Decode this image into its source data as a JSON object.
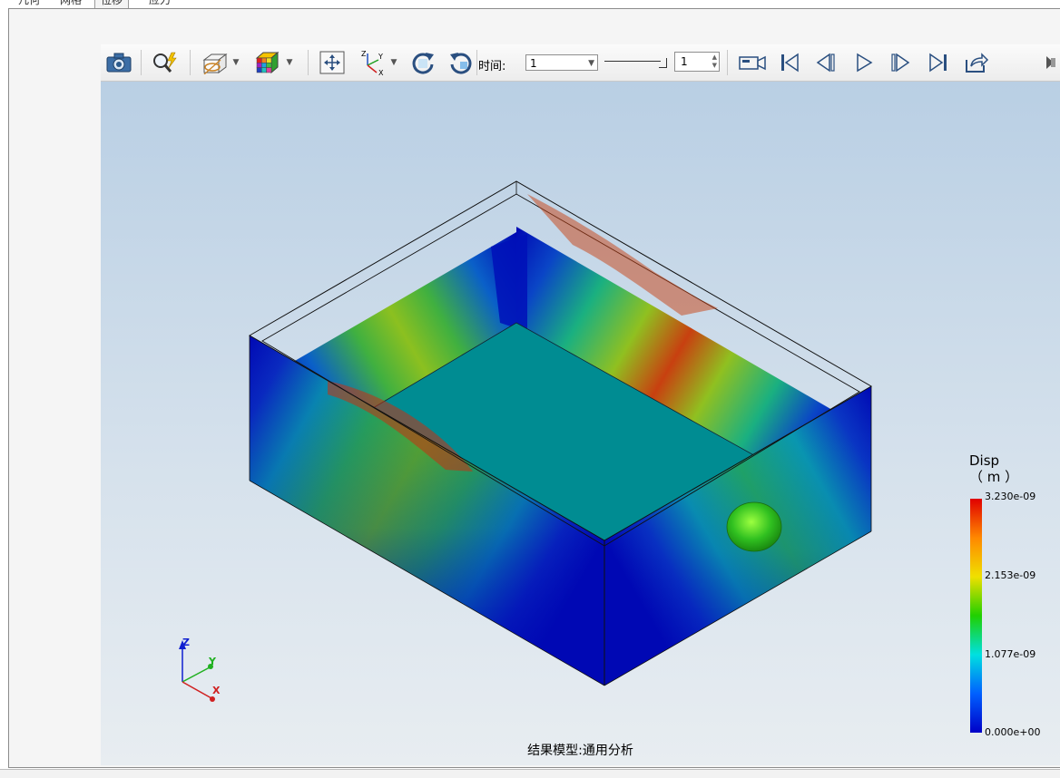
{
  "tabs": [
    {
      "label": "几何"
    },
    {
      "label": "网格"
    },
    {
      "label": "位移"
    },
    {
      "label": "应力"
    }
  ],
  "toolbar": {
    "time_label": "时间:",
    "time_value": "1",
    "frame_value": "1",
    "icons": [
      "camera-icon",
      "query-icon",
      "section-view-icon",
      "color-map-icon",
      "fit-view-icon",
      "axes-icon",
      "rotate-cw-icon",
      "rotate-ccw-icon",
      "record-icon",
      "first-frame-icon",
      "prev-frame-icon",
      "play-icon",
      "next-frame-icon",
      "last-frame-icon",
      "export-icon",
      "more-icon"
    ]
  },
  "viewport": {
    "footer": "结果模型:通用分析",
    "triad": {
      "z": "Z",
      "y": "Y",
      "x": "X"
    }
  },
  "legend": {
    "title": "Disp",
    "unit": "（ m ）",
    "max": "3.230e-09",
    "v2": "2.153e-09",
    "v1": "1.077e-09",
    "min": "0.000e+00",
    "colors": [
      "#e00000",
      "#ff8800",
      "#f0e000",
      "#20d000",
      "#00e0e0",
      "#0060ff",
      "#0000c8"
    ]
  }
}
